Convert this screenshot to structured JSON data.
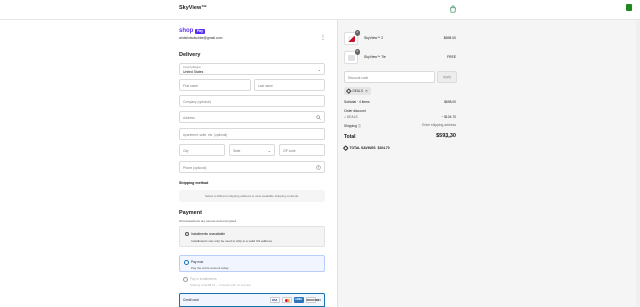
{
  "header": {
    "title": "SkyView™"
  },
  "account": {
    "shop_word": "shop",
    "shop_badge": "Pay",
    "email": "ahdsfcdsdscbbe@gmail.com"
  },
  "delivery": {
    "heading": "Delivery",
    "country_label": "Country/Region",
    "country_value": "United States",
    "first_name_placeholder": "First name",
    "last_name_placeholder": "Last name",
    "company_placeholder": "Company (optional)",
    "address_placeholder": "Address",
    "apartment_placeholder": "Apartment, suite, etc. (optional)",
    "city_placeholder": "City",
    "state_placeholder": "State",
    "zip_placeholder": "ZIP code",
    "phone_placeholder": "Phone (optional)"
  },
  "shipping": {
    "heading": "Shipping method",
    "message": "Select a different shipping address to view available shipping methods."
  },
  "payment": {
    "heading": "Payment",
    "subtitle": "All transactions are secure and encrypted.",
    "installments_title": "Installments unavailable",
    "installments_body": "Installments can only be used to ship to a valid US address.",
    "pay_now_title": "Pay now",
    "pay_now_sub": "Pay the entire amount today",
    "pay_inst_title": "Pay in installments",
    "pay_inst_sub": "Starting at $198.10 – 3 weeks with no interest",
    "credit_card_label": "Credit card",
    "brands": [
      "VISA",
      "MC",
      "AMEX",
      "DISCOVER"
    ],
    "more_brands": "+5"
  },
  "order": {
    "items": [
      {
        "name": "SkyView™ 2",
        "price": "$698.00",
        "qty": "2"
      },
      {
        "name": "SkyView™ Tie",
        "price": "FREE",
        "qty": "2"
      }
    ],
    "discount_placeholder": "Discount code",
    "apply_label": "Apply",
    "applied_code": "DEALS",
    "subtotal_label": "Subtotal · 4 items",
    "subtotal_value": "$698.00",
    "order_discount_label": "Order discount",
    "code_line_label": "DEALS",
    "code_line_value": "− $104.70",
    "shipping_label": "Shipping",
    "shipping_value": "Enter shipping address",
    "total_label": "Total",
    "total_currency": "USD",
    "total_value": "$593.30",
    "savings_label": "TOTAL SAVINGS",
    "savings_value": "$104.70"
  },
  "colors": {
    "shop_purple": "#5a31f4",
    "accent_blue": "#1773b0",
    "panel_bg": "#f5f5f5"
  }
}
